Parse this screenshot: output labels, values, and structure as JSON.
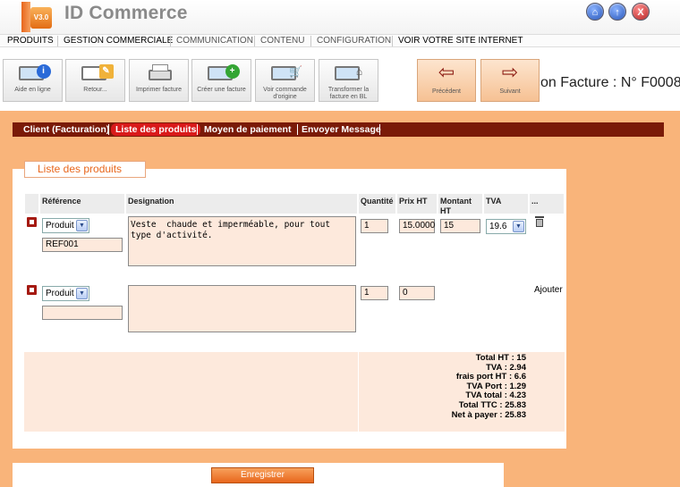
{
  "app": {
    "title": "ID Commerce",
    "version_badge": "V3.0"
  },
  "menu": [
    "PRODUITS",
    "GESTION COMMERCIALE",
    "COMMUNICATION",
    "CONTENU",
    "CONFIGURATION",
    "VOIR VOTRE SITE INTERNET"
  ],
  "toolbar": {
    "help": "Aide en ligne",
    "back": "Retour...",
    "print": "Imprimer facture",
    "create": "Créer une facture",
    "view_order": "Voir commande d'origine",
    "transform": "Transformer la facture en BL",
    "prev": "Précédent",
    "next": "Suivant"
  },
  "page_heading": "on Facture : N° F0008",
  "tabs": [
    "Client (Facturation)",
    "Liste des produits",
    "Moyen de paiement",
    "Envoyer Message"
  ],
  "active_tab": "Liste des produits",
  "section_title": "Liste des produits",
  "columns": {
    "reference": "Référence",
    "designation": "Designation",
    "quantite": "Quantité",
    "prix_ht": "Prix HT",
    "montant_ht": "Montant HT",
    "tva": "TVA",
    "more": "..."
  },
  "rows": [
    {
      "type": "Produit",
      "reference": "REF001",
      "designation": "Veste  chaude et imperméable, pour tout type d'activité.",
      "quantite": "1",
      "prix_ht": "15.0000",
      "montant_ht": "15",
      "tva": "19.6"
    }
  ],
  "new_row": {
    "type": "Produit",
    "reference": "",
    "designation": "",
    "quantite": "1",
    "prix_ht": "0",
    "add_label": "Ajouter"
  },
  "totals": [
    "Total HT : 15",
    "TVA : 2.94",
    "frais port HT : 6.6",
    "TVA Port : 1.29",
    "TVA total : 4.23",
    "Total TTC : 25.83",
    "Net à payer : 25.83"
  ],
  "save_button": "Enregistrer",
  "colors": {
    "accent": "#e8661c",
    "panel": "#f9b47a",
    "tab_bar": "#7a1a08",
    "tab_active": "#d91a1a",
    "field_bg": "#fde9dc"
  }
}
